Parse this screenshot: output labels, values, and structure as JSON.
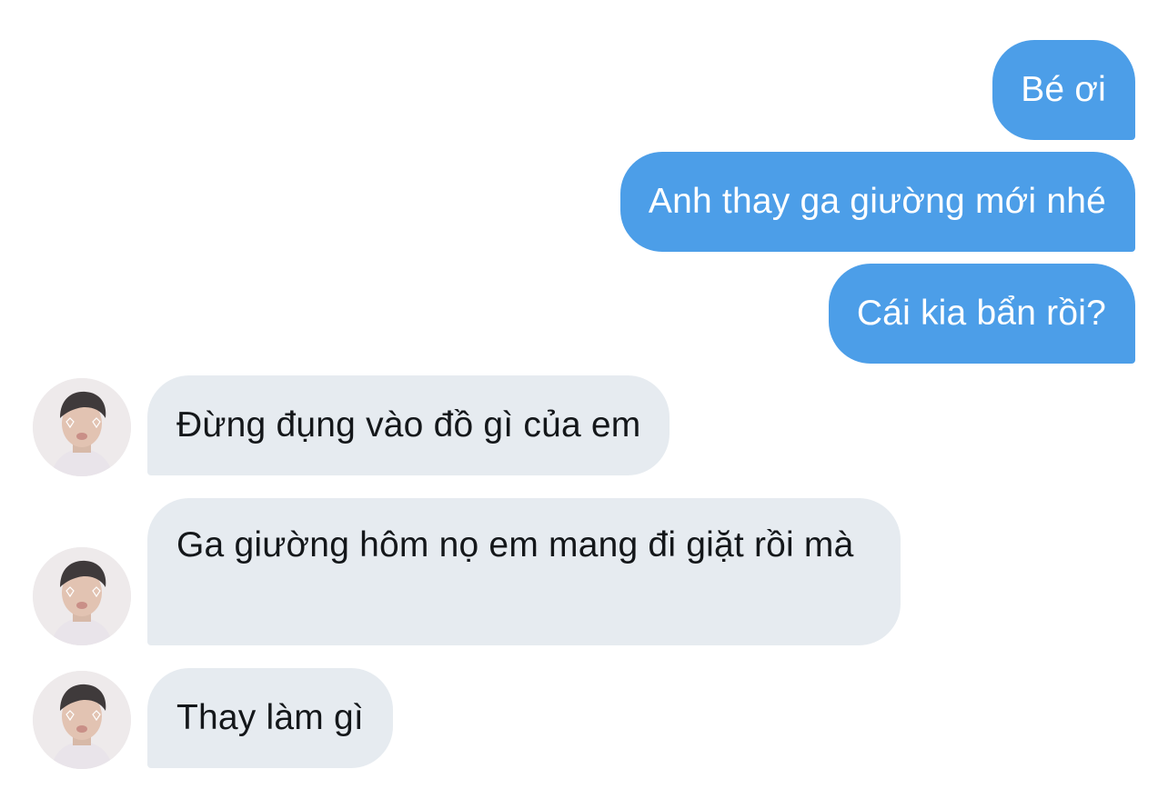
{
  "conversation": {
    "outgoing": [
      {
        "text": "Bé ơi"
      },
      {
        "text": "Anh thay ga giường mới nhé"
      },
      {
        "text": "Cái kia bẩn rồi?"
      }
    ],
    "incoming": [
      {
        "text": "Đừng đụng vào đồ gì của em"
      },
      {
        "text": "Ga giường hôm nọ em mang đi giặt rồi mà"
      },
      {
        "text": "Thay làm gì"
      }
    ]
  },
  "colors": {
    "outgoing_bubble": "#4c9ee8",
    "incoming_bubble": "#e6ebf0",
    "outgoing_text": "#ffffff",
    "incoming_text": "#14171a"
  }
}
